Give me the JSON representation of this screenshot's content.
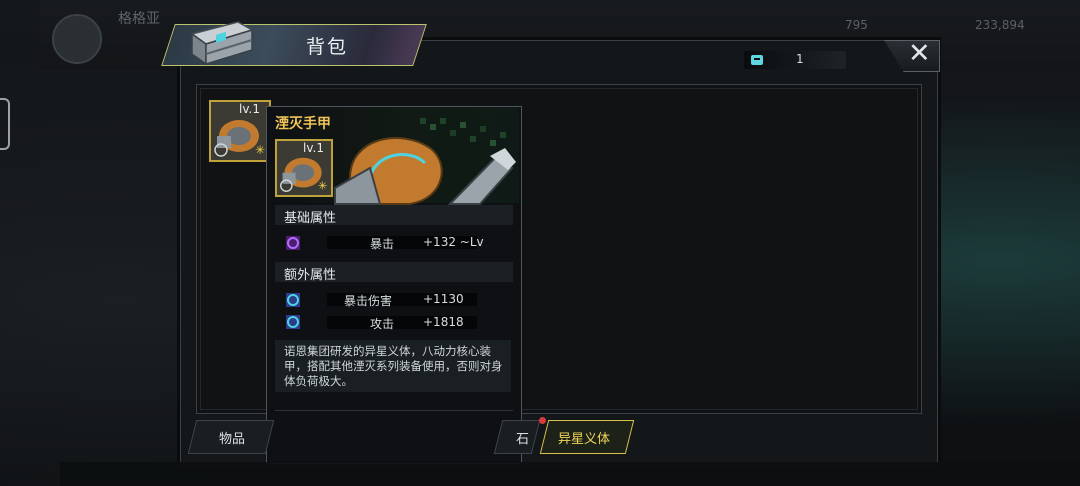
{
  "background": {
    "player_name": "格格亚",
    "stat_1": "795",
    "stat_2": "233,894"
  },
  "window": {
    "title": "背包",
    "counter_value": "1",
    "close_icon": "close-icon"
  },
  "inventory": {
    "slot_level": "lv.1"
  },
  "tooltip": {
    "item_name": "湮灭手甲",
    "item_level": "lv.1",
    "base_section_label": "基础属性",
    "base_attrs": [
      {
        "name": "暴击",
        "value": "+132 ~Lv"
      }
    ],
    "extra_section_label": "额外属性",
    "extra_attrs": [
      {
        "name": "暴击伤害",
        "value": "+1130"
      },
      {
        "name": "攻击",
        "value": "+1818"
      }
    ],
    "description": "诺恩集团研发的异星义体，八动力核心装甲，搭配其他湮灭系列装备使用，否则对身体负荷极大。"
  },
  "tabs": [
    {
      "label": "物品",
      "active": false
    },
    {
      "label": "石",
      "active": false
    },
    {
      "label": "异星义体",
      "active": true
    }
  ],
  "colors": {
    "gold": "#bfa23a",
    "item_name": "#f1c55a",
    "alert_dot": "#d83a3a"
  }
}
